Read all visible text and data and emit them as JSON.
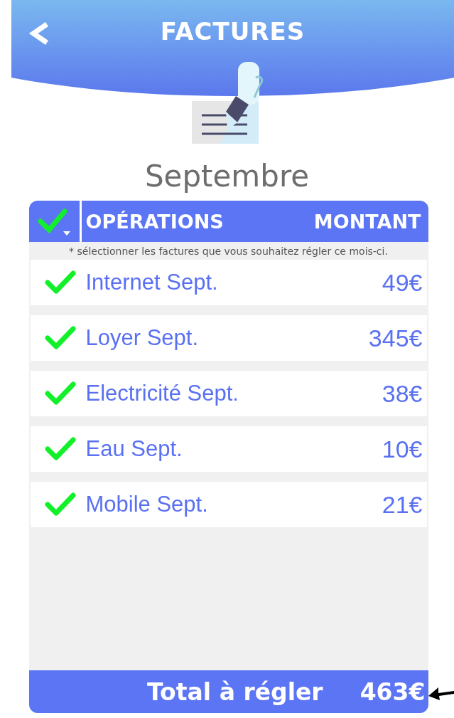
{
  "header": {
    "title": "FACTURES"
  },
  "month": "Septembre",
  "table": {
    "select_all_checked": true,
    "columns": [
      "OPÉRATIONS",
      "MONTANT"
    ],
    "note": "* sélectionner les factures que vous souhaitez régler ce mois-ci.",
    "rows": [
      {
        "label": "Internet Sept.",
        "amount": "49€",
        "checked": true
      },
      {
        "label": "Loyer Sept.",
        "amount": "345€",
        "checked": true
      },
      {
        "label": "Electricité Sept.",
        "amount": "38€",
        "checked": true
      },
      {
        "label": "Eau Sept.",
        "amount": "10€",
        "checked": true
      },
      {
        "label": "Mobile Sept.",
        "amount": "21€",
        "checked": true
      }
    ],
    "total_label": "Total à régler",
    "total_amount": "463€"
  }
}
